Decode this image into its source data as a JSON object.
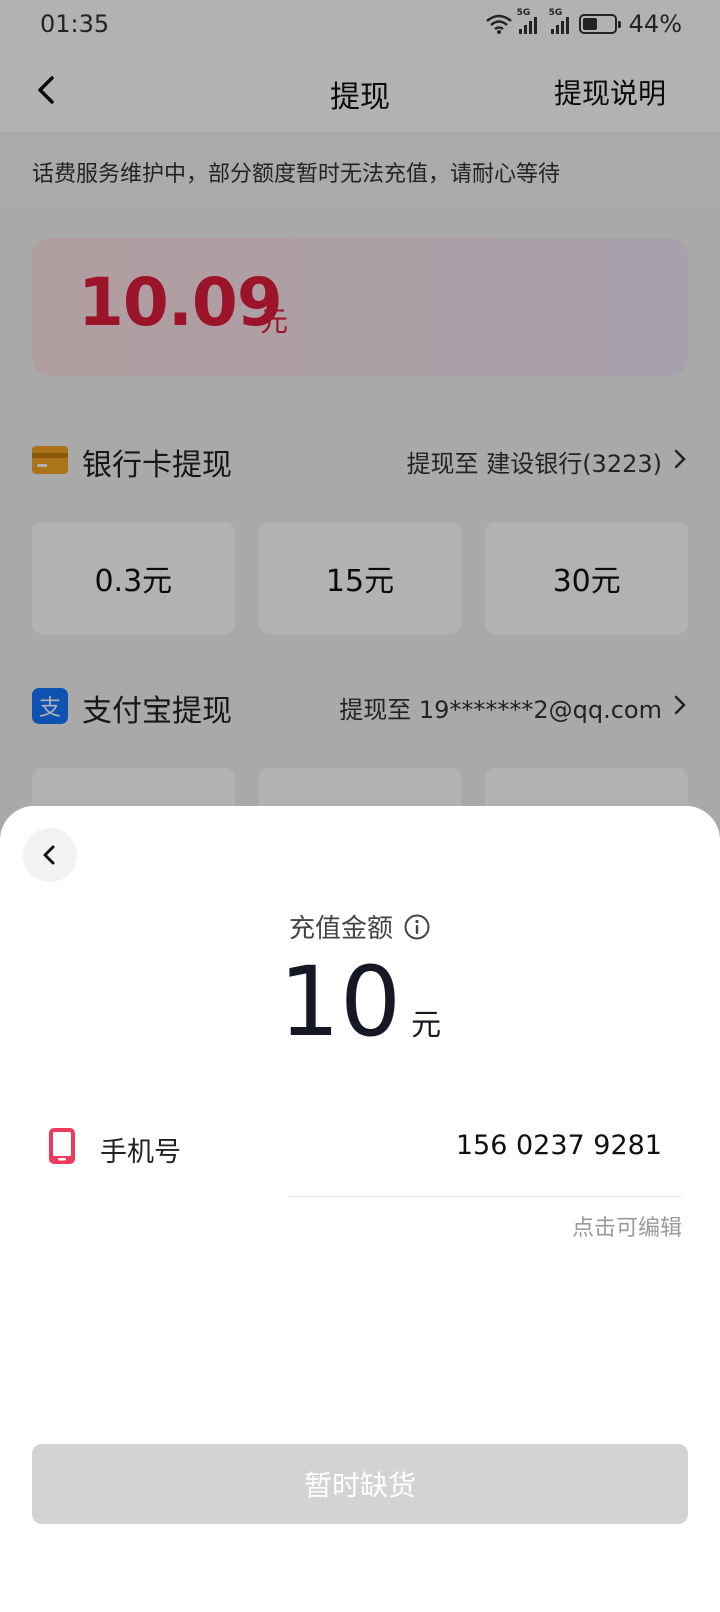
{
  "status_bar": {
    "time": "01:35",
    "network_tag_1": "5G",
    "network_tag_2": "5G",
    "battery": "44%"
  },
  "nav": {
    "title": "提现",
    "help_link": "提现说明"
  },
  "notice": "话费服务维护中，部分额度暂时无法充值，请耐心等待",
  "balance": {
    "amount": "10.09",
    "unit": "元"
  },
  "bank": {
    "title": "银行卡提现",
    "destination": "提现至 建设银行(3223)",
    "amounts": [
      "0.3元",
      "15元",
      "30元"
    ]
  },
  "alipay": {
    "title": "支付宝提现",
    "destination": "提现至 19*******2@qq.com"
  },
  "sheet": {
    "label": "充值金额",
    "amount": "10",
    "unit": "元",
    "phone_label": "手机号",
    "phone_value": "156 0237 9281",
    "edit_hint": "点击可编辑",
    "button": "暂时缺货"
  },
  "colors": {
    "accent_red": "#e01e3c",
    "bank_icon": "#f5a623",
    "alipay_icon": "#1677ff",
    "phone_icon": "#ee3a5a",
    "disabled_button": "#d3d3d3"
  }
}
